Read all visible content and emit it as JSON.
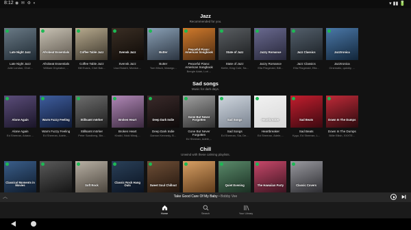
{
  "status_bar": {
    "time": "8:12",
    "icons": "◉ ✉ ⚙ ◐",
    "right": "▾ ▮▮ 🔋"
  },
  "sections": [
    {
      "title": "Jazz",
      "subtitle": "Recommended for you.",
      "cards": [
        {
          "cover_text": "Late Night Jazz",
          "title": "Late Night Jazz",
          "sub": "Julie London, Chet ...",
          "colors": [
            "#6a7a86",
            "#1f2a33"
          ]
        },
        {
          "cover_text": "Afrobeat Essentials",
          "title": "Afrobeat Essentials",
          "sub": "William Onyeabor, ...",
          "colors": [
            "#c8c2b4",
            "#5e574e"
          ]
        },
        {
          "cover_text": "Coffee Table Jazz",
          "title": "Coffee Table Jazz",
          "sub": "Bill Evans, Chet Bak...",
          "colors": [
            "#b7aa8e",
            "#3b352b"
          ]
        },
        {
          "cover_text": "Svensk Jazz",
          "title": "Svensk Jazz",
          "sub": "Lisa Ekdahl, Monica ...",
          "colors": [
            "#3a2e24",
            "#0e0a07"
          ]
        },
        {
          "cover_text": "Butter",
          "title": "Butter",
          "sub": "Tom Misch, Masego...",
          "colors": [
            "#8aa0b5",
            "#2b3440"
          ]
        },
        {
          "cover_text": "Peaceful Piano: American Songbook",
          "title": "Peaceful Piano: American Songbook",
          "sub": "Beegie Adair, Lori ...",
          "colors": [
            "#d07a2c",
            "#4a2b12"
          ]
        },
        {
          "cover_text": "State of Jazz",
          "title": "State of Jazz",
          "sub": "Kiefer, King Cole, Sa...",
          "colors": [
            "#5a5e62",
            "#1c1e20"
          ]
        },
        {
          "cover_text": "Jazzy Romance",
          "title": "Jazzy Romance",
          "sub": "Ella Fitzgerald, Billi...",
          "colors": [
            "#6a6a90",
            "#262638"
          ]
        },
        {
          "cover_text": "Jazz Classics",
          "title": "Jazz Classics",
          "sub": "Ella Fitzgerald, Ella...",
          "colors": [
            "#54606c",
            "#1a1f24"
          ]
        },
        {
          "cover_text": "Jazztronica",
          "title": "Jazztronica",
          "sub": "Cinematic, quickly, ...",
          "colors": [
            "#4b78a8",
            "#12263a"
          ]
        }
      ]
    },
    {
      "title": "Sad songs",
      "subtitle": "Music for dark days.",
      "cards": [
        {
          "cover_text": "Alone Again",
          "title": "Alone Again",
          "sub": "Ed Sheeran, Ariana ...",
          "colors": [
            "#5b4d7a",
            "#1a1528"
          ]
        },
        {
          "cover_text": "Warm Fuzzy Feeling",
          "title": "Warm Fuzzy Feeling",
          "sub": "Ed Sheeran, Adele,...",
          "colors": [
            "#3f5e9e",
            "#0f1a36"
          ]
        },
        {
          "cover_text": "Stillsamt mörker",
          "title": "Stillsamt mörker",
          "sub": "Peter Sandberg, Bin...",
          "colors": [
            "#6e6e6e",
            "#1e1e1e"
          ]
        },
        {
          "cover_text": "Broken Heart",
          "title": "Broken Heart",
          "sub": "Khalid, Nicki Minaj,...",
          "colors": [
            "#b088b6",
            "#3c2a40"
          ]
        },
        {
          "cover_text": "Deep Dark Indie",
          "title": "Deep Dark Indie",
          "sub": "Damon Kennedy, B...",
          "colors": [
            "#3a2a2a",
            "#0e0a0a"
          ]
        },
        {
          "cover_text": "Gone But Never Forgotten",
          "title": "Gone But Never Forgotten",
          "sub": "Ed Sheeran, Adele,...",
          "colors": [
            "#a0a0a0",
            "#303030"
          ]
        },
        {
          "cover_text": "Sad Songs",
          "title": "Sad Songs",
          "sub": "Ed Sheeran, Sia, De...",
          "colors": [
            "#cfd6de",
            "#7a8390"
          ]
        },
        {
          "cover_text": "Heartbreaker",
          "title": "Heartbreaker",
          "sub": "Ed Sheeran, Adele,...",
          "colors": [
            "#f2f2f2",
            "#d8d8d8"
          ]
        },
        {
          "cover_text": "Sad Beats",
          "title": "Sad Beats",
          "sub": "Kygo, Ed Sheeran, L...",
          "colors": [
            "#c21e2e",
            "#3c0910"
          ]
        },
        {
          "cover_text": "Down In The Dumps",
          "title": "Down In The Dumps",
          "sub": "Billie Eilish, XXXTE...",
          "colors": [
            "#c02a38",
            "#2a0a0e"
          ]
        }
      ]
    },
    {
      "title": "Chill",
      "subtitle": "Unwind with these calming playlists.",
      "cards": [
        {
          "cover_text": "Classical Moments in Movies",
          "title": "",
          "sub": "",
          "colors": [
            "#3a5e8a",
            "#0e1a2a"
          ]
        },
        {
          "cover_text": "",
          "title": "",
          "sub": "",
          "colors": [
            "#5a5a5a",
            "#141414"
          ]
        },
        {
          "cover_text": "Soft Rock",
          "title": "",
          "sub": "",
          "colors": [
            "#b8b0a4",
            "#4a443c"
          ]
        },
        {
          "cover_text": "Classic Rock Hang Outs",
          "title": "",
          "sub": "",
          "colors": [
            "#2a4058",
            "#0a1220"
          ]
        },
        {
          "cover_text": "Sweet Soul Chillout",
          "title": "",
          "sub": "",
          "colors": [
            "#6e4e36",
            "#22160e"
          ]
        },
        {
          "cover_text": "",
          "title": "",
          "sub": "",
          "colors": [
            "#d8a064",
            "#5e3a1a"
          ]
        },
        {
          "cover_text": "Quiet Evening",
          "title": "",
          "sub": "",
          "colors": [
            "#5a8a6a",
            "#1a2e22"
          ]
        },
        {
          "cover_text": "The Hawaiian Party",
          "title": "",
          "sub": "",
          "colors": [
            "#c8486a",
            "#3a1420"
          ]
        },
        {
          "cover_text": "Classic Covers",
          "title": "",
          "sub": "",
          "colors": [
            "#9a9aa0",
            "#2a2a2e"
          ]
        }
      ]
    }
  ],
  "now_playing": {
    "track": "Take Good Care Of My Baby",
    "separator": " • ",
    "artist": "Bobby Vee"
  },
  "tabs": [
    {
      "label": "Home",
      "icon": "home-icon",
      "active": true
    },
    {
      "label": "Search",
      "icon": "search-icon",
      "active": false
    },
    {
      "label": "Your Library",
      "icon": "library-icon",
      "active": false
    }
  ],
  "colors": {
    "background": "#121212",
    "accent": "#1db954",
    "player_bar": "#282828"
  }
}
